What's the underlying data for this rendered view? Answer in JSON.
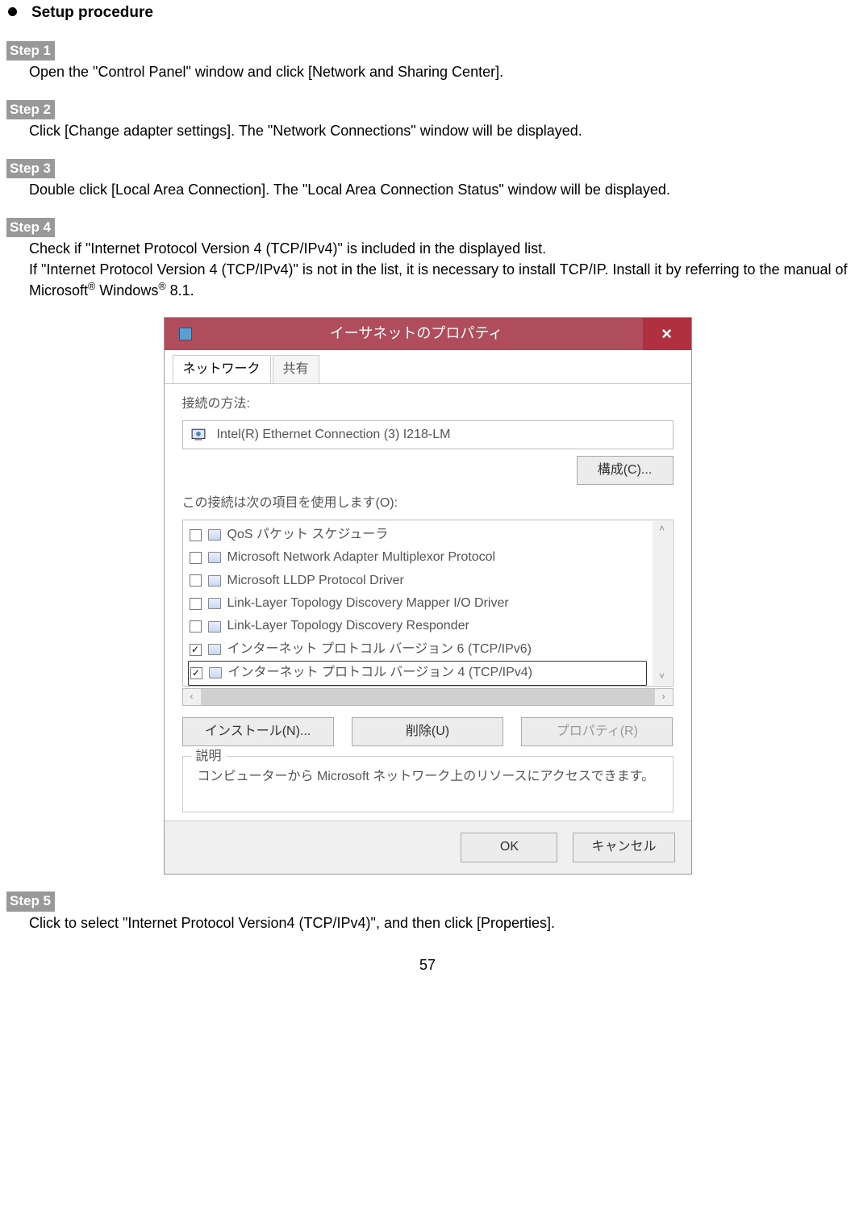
{
  "header": {
    "title": "Setup procedure"
  },
  "steps": [
    {
      "label": "Step 1",
      "text": "Open the \"Control Panel\" window and click [Network and Sharing Center]."
    },
    {
      "label": "Step 2",
      "text": "Click [Change adapter settings]. The \"Network Connections\" window will be displayed."
    },
    {
      "label": "Step 3",
      "text": "Double click [Local Area Connection]. The \"Local Area Connection Status\" window will be displayed."
    },
    {
      "label": "Step 4",
      "line1": "Check if \"Internet Protocol Version 4 (TCP/IPv4)\" is included in the displayed list.",
      "line2a": "If \"Internet Protocol Version 4 (TCP/IPv4)\" is not in the list, it is necessary to install TCP/IP. Install it by referring to the manual of Microsoft",
      "line2b": " Windows",
      "line2c": " 8.1."
    },
    {
      "label": "Step 5",
      "text": "Click to select \"Internet Protocol Version4 (TCP/IPv4)\", and then click [Properties]."
    }
  ],
  "dialog": {
    "title": "イーサネットのプロパティ",
    "closeGlyph": "×",
    "tabs": [
      "ネットワーク",
      "共有"
    ],
    "connectLabel": "接続の方法:",
    "adapter": "Intel(R) Ethernet Connection (3) I218-LM",
    "configureBtn": "構成(C)...",
    "itemsLabel": "この接続は次の項目を使用します(O):",
    "items": [
      {
        "checked": false,
        "label": "QoS パケット スケジューラ"
      },
      {
        "checked": false,
        "label": "Microsoft Network Adapter Multiplexor Protocol"
      },
      {
        "checked": false,
        "label": "Microsoft LLDP Protocol Driver"
      },
      {
        "checked": false,
        "label": "Link-Layer Topology Discovery Mapper I/O Driver"
      },
      {
        "checked": false,
        "label": "Link-Layer Topology Discovery Responder"
      },
      {
        "checked": true,
        "label": "インターネット プロトコル バージョン 6 (TCP/IPv6)"
      },
      {
        "checked": true,
        "label": "インターネット プロトコル バージョン 4 (TCP/IPv4)",
        "highlight": true
      }
    ],
    "installBtn": "インストール(N)...",
    "removeBtn": "削除(U)",
    "propertiesBtn": "プロパティ(R)",
    "descLabel": "説明",
    "descText": "コンピューターから Microsoft ネットワーク上のリソースにアクセスできます。",
    "okBtn": "OK",
    "cancelBtn": "キャンセル"
  },
  "pageNumber": "57"
}
